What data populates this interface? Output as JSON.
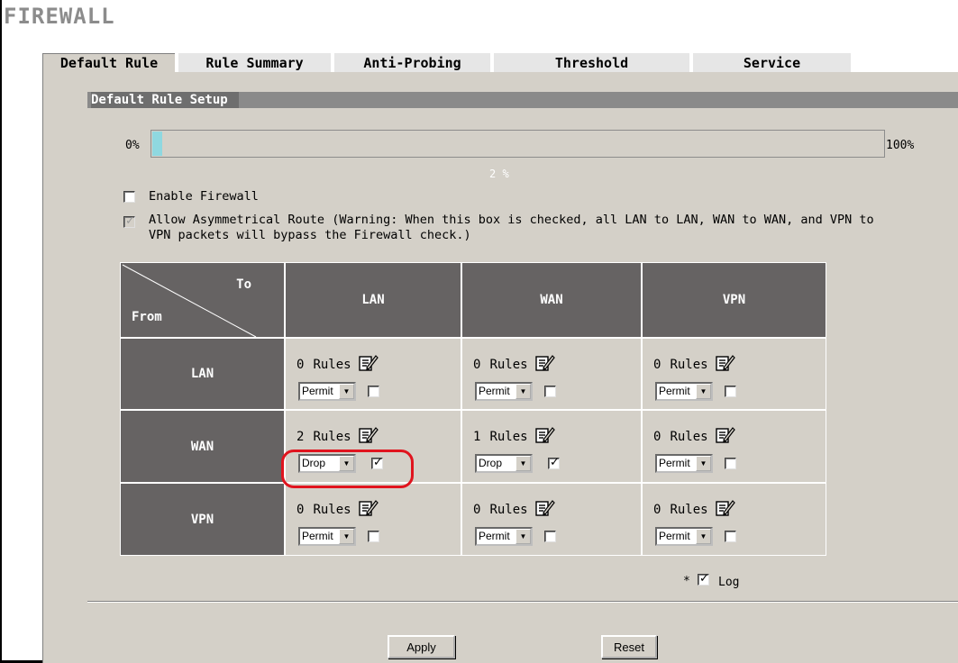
{
  "page": {
    "title": "FIREWALL"
  },
  "tabs": [
    {
      "label": "Default Rule",
      "active": true
    },
    {
      "label": "Rule Summary",
      "active": false
    },
    {
      "label": "Anti-Probing",
      "active": false
    },
    {
      "label": "Threshold",
      "active": false
    },
    {
      "label": "Service",
      "active": false
    }
  ],
  "section": {
    "title": "Default Rule Setup"
  },
  "progress": {
    "min_label": "0%",
    "max_label": "100%",
    "value_label": "2 %",
    "fraction": 0.02
  },
  "options": {
    "enable_firewall": {
      "label": "Enable Firewall",
      "checked": false
    },
    "asymmetric_route": {
      "label_line1": "Allow Asymmetrical Route (Warning: When this box is checked, all LAN to LAN, WAN to WAN, and VPN to",
      "label_line2": "VPN packets will bypass the Firewall check.)",
      "checked": true,
      "disabled": true
    }
  },
  "matrix": {
    "to_label": "To",
    "from_label": "From",
    "columns": [
      "LAN",
      "WAN",
      "VPN"
    ],
    "rows": [
      {
        "label": "LAN",
        "cells": [
          {
            "count": "0",
            "rules_label": "Rules",
            "action": "Permit",
            "log": false
          },
          {
            "count": "0",
            "rules_label": "Rules",
            "action": "Permit",
            "log": false
          },
          {
            "count": "0",
            "rules_label": "Rules",
            "action": "Permit",
            "log": false
          }
        ]
      },
      {
        "label": "WAN",
        "cells": [
          {
            "count": "2",
            "rules_label": "Rules",
            "action": "Drop",
            "log": true
          },
          {
            "count": "1",
            "rules_label": "Rules",
            "action": "Drop",
            "log": true
          },
          {
            "count": "0",
            "rules_label": "Rules",
            "action": "Permit",
            "log": false
          }
        ]
      },
      {
        "label": "VPN",
        "cells": [
          {
            "count": "0",
            "rules_label": "Rules",
            "action": "Permit",
            "log": false
          },
          {
            "count": "0",
            "rules_label": "Rules",
            "action": "Permit",
            "log": false
          },
          {
            "count": "0",
            "rules_label": "Rules",
            "action": "Permit",
            "log": false
          }
        ]
      }
    ]
  },
  "legend": {
    "star": "*",
    "log_label": "Log",
    "checked": true
  },
  "buttons": {
    "apply": "Apply",
    "reset": "Reset"
  },
  "colors": {
    "highlight": "#e0141e",
    "progress_fill": "#8fd8e0",
    "header_dark": "#666363"
  },
  "icons": {
    "edit": "edit-rules-icon"
  }
}
